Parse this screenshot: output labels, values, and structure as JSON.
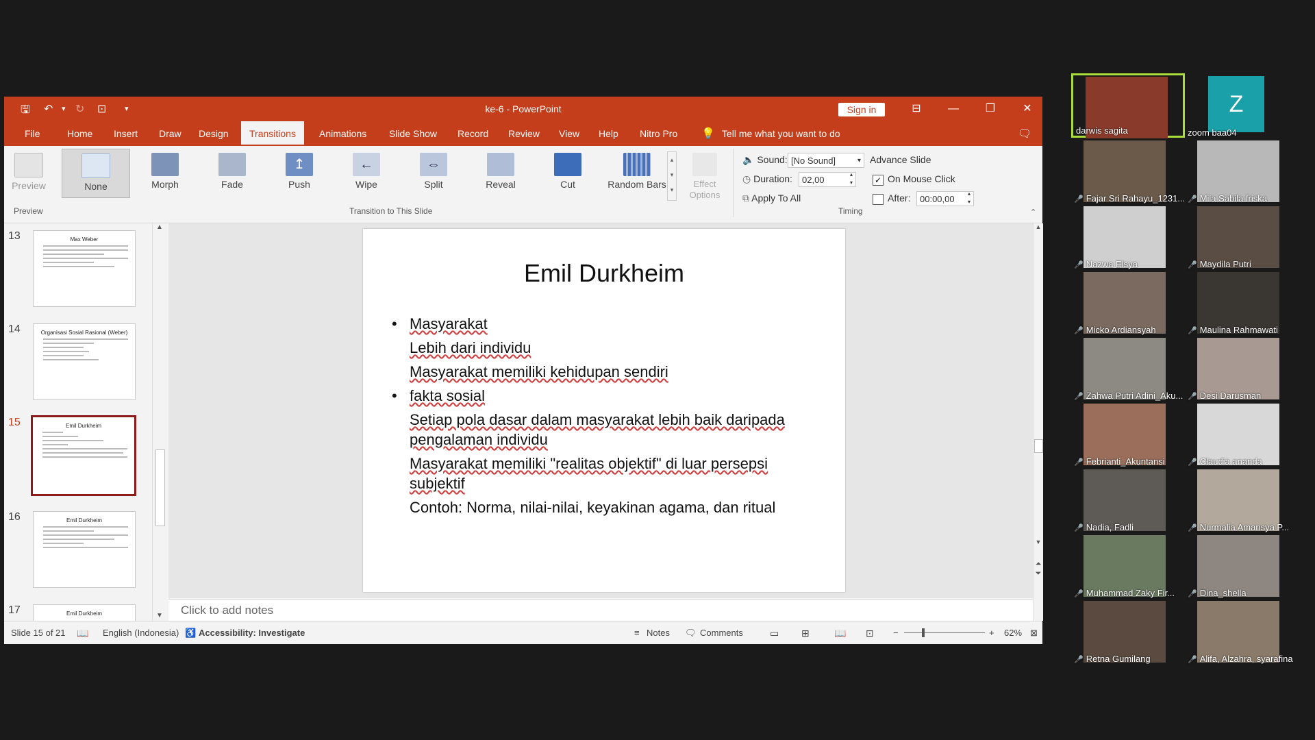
{
  "ppt": {
    "title": "ke-6  -  PowerPoint",
    "sign_in": "Sign in",
    "tabs": [
      "File",
      "Home",
      "Insert",
      "Draw",
      "Design",
      "Transitions",
      "Animations",
      "Slide Show",
      "Record",
      "Review",
      "View",
      "Help",
      "Nitro Pro"
    ],
    "active_tab": "Transitions",
    "tell_me": "Tell me what you want to do",
    "ribbon": {
      "preview_label": "Preview",
      "preview_group": "Preview",
      "transitions": [
        "None",
        "Morph",
        "Fade",
        "Push",
        "Wipe",
        "Split",
        "Reveal",
        "Cut",
        "Random Bars"
      ],
      "effect_options": "Effect Options",
      "transition_group": "Transition to This Slide",
      "sound_label": "Sound:",
      "sound_value": "[No Sound]",
      "duration_label": "Duration:",
      "duration_value": "02,00",
      "apply_all": "Apply To All",
      "advance_slide": "Advance Slide",
      "on_mouse_click": "On Mouse Click",
      "after_label": "After:",
      "after_value": "00:00,00",
      "timing_group": "Timing"
    },
    "thumbnails": [
      {
        "num": "13",
        "title": "Max Weber"
      },
      {
        "num": "14",
        "title": "Organisasi Sosial Rasional (Weber)"
      },
      {
        "num": "15",
        "title": "Emil Durkheim"
      },
      {
        "num": "16",
        "title": "Emil Durkheim"
      },
      {
        "num": "17",
        "title": "Emil Durkheim"
      }
    ],
    "slide": {
      "title": "Emil Durkheim",
      "lines": [
        "Masyarakat",
        "Lebih dari individu",
        "Masyarakat memiliki kehidupan sendiri",
        "fakta sosial",
        "Setiap pola dasar dalam masyarakat lebih baik daripada",
        "pengalaman individu",
        "Masyarakat memiliki \"realitas objektif\" di luar persepsi",
        "subjektif",
        "Contoh: Norma, nilai-nilai, keyakinan agama, dan ritual"
      ]
    },
    "notes_placeholder": "Click to add notes",
    "status": {
      "slide": "Slide 15 of 21",
      "language": "English (Indonesia)",
      "accessibility": "Accessibility: Investigate",
      "notes": "Notes",
      "comments": "Comments",
      "zoom": "62%"
    }
  },
  "participants": [
    {
      "name": "darwis sagita",
      "speaking": true,
      "color": "#8a3a2a"
    },
    {
      "name": "zoom baa04",
      "speaking": false,
      "color": "#1aa0a8",
      "avatar": "Z"
    },
    {
      "name": "Fajar Sri Rahayu_1231...",
      "speaking": false,
      "color": "#6b5a4a"
    },
    {
      "name": "Mila Sabila friska",
      "speaking": false,
      "color": "#b8b8b8"
    },
    {
      "name": "Nazwa Elsya",
      "speaking": false,
      "color": "#cfcfcf"
    },
    {
      "name": "Maydila Putri",
      "speaking": false,
      "color": "#5a4d44"
    },
    {
      "name": "Micko Ardiansyah",
      "speaking": false,
      "color": "#7a6a60"
    },
    {
      "name": "Maulina Rahmawati",
      "speaking": false,
      "color": "#3a3632"
    },
    {
      "name": "Zahwa Putri Adini_Aku...",
      "speaking": false,
      "color": "#8c8a82"
    },
    {
      "name": "Desi Darusman",
      "speaking": false,
      "color": "#a89a92"
    },
    {
      "name": "Febrianti_Akuntansi",
      "speaking": false,
      "color": "#9a6e5a"
    },
    {
      "name": "Claudia ananda",
      "speaking": false,
      "color": "#d8d8d8"
    },
    {
      "name": "Nadia, Fadli",
      "speaking": false,
      "color": "#5e5a56"
    },
    {
      "name": "Nurmalia Amansya P...",
      "speaking": false,
      "color": "#b2a89c"
    },
    {
      "name": "Muhammad Zaky Fir...",
      "speaking": false,
      "color": "#6a7a60"
    },
    {
      "name": "Dina_shella",
      "speaking": false,
      "color": "#8e8680"
    },
    {
      "name": "Retna Gumilang",
      "speaking": false,
      "color": "#5a4a40"
    },
    {
      "name": "Alifa, Alzahra, syarafina",
      "speaking": false,
      "color": "#8a7a6a"
    }
  ]
}
